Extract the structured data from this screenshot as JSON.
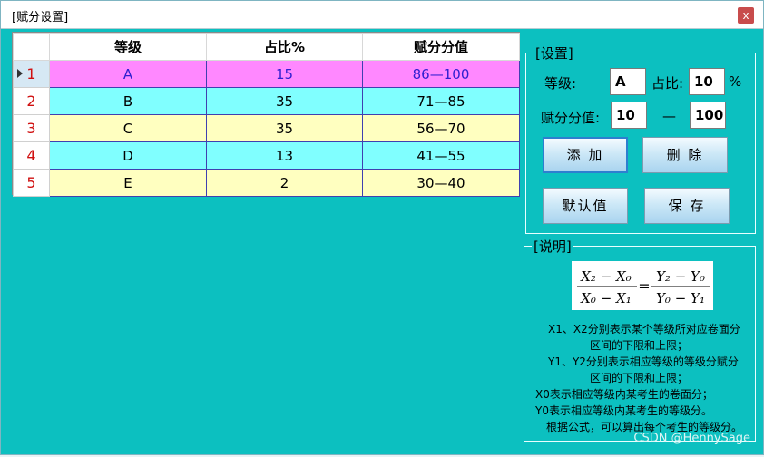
{
  "window": {
    "title": "[赋分设置]",
    "close_glyph": "x"
  },
  "grid": {
    "columns": [
      "等级",
      "占比%",
      "赋分分值"
    ],
    "rows": [
      {
        "num": "1",
        "grade": "A",
        "ratio": "15",
        "range": "86—100",
        "bg": "#ff88ff",
        "fg": "#3020d0"
      },
      {
        "num": "2",
        "grade": "B",
        "ratio": "35",
        "range": "71—85",
        "bg": "#80ffff",
        "fg": "#000000"
      },
      {
        "num": "3",
        "grade": "C",
        "ratio": "35",
        "range": "56—70",
        "bg": "#ffffc0",
        "fg": "#000000"
      },
      {
        "num": "4",
        "grade": "D",
        "ratio": "13",
        "range": "41—55",
        "bg": "#80ffff",
        "fg": "#000000"
      },
      {
        "num": "5",
        "grade": "E",
        "ratio": "2",
        "range": "30—40",
        "bg": "#ffffc0",
        "fg": "#000000"
      }
    ],
    "selected_row": 1
  },
  "settings": {
    "group_label": "[设置]",
    "grade_label": "等级:",
    "grade_value": "A",
    "ratio_label": "占比:",
    "ratio_value": "10",
    "percent_sign": "%",
    "score_label": "赋分分值:",
    "score_min": "10",
    "dash": "—",
    "score_max": "100",
    "add_button": "添 加",
    "delete_button": "删 除",
    "default_button": "默认值",
    "save_button": "保 存"
  },
  "explain": {
    "group_label": "[说明]",
    "formula": {
      "left_num": "X₂ − X₀",
      "left_den": "X₀ − X₁",
      "equals": "=",
      "right_num": "Y₂ − Y₀",
      "right_den": "Y₀ − Y₁"
    },
    "notes": [
      "X1、X2分别表示某个等级所对应卷面分",
      "区间的下限和上限；",
      "Y1、Y2分别表示相应等级的等级分赋分",
      "区间的下限和上限；",
      "X0表示相应等级内某考生的卷面分；",
      "Y0表示相应等级内某考生的等级分。",
      "根据公式，可以算出每个考生的等级分。"
    ]
  },
  "watermark": "CSDN @HennySage"
}
